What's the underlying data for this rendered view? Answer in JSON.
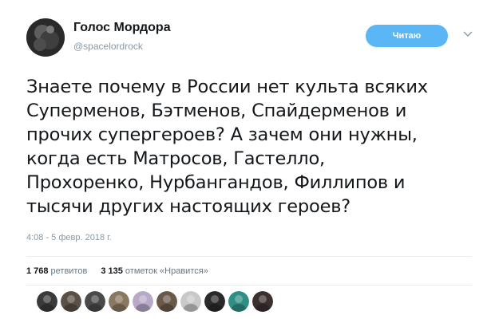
{
  "author": {
    "display_name": "Голос Мордора",
    "handle": "@spacelordrock",
    "avatar_icon": "avatar-photo"
  },
  "follow_button": {
    "label": "Читаю",
    "color": "#5bb6f5"
  },
  "menu_icon": "chevron-down-icon",
  "tweet": {
    "lines": [
      "Знаете почему в России нет культа всяких",
      "Суперменов, Бэтменов, Спайдерменов и",
      "прочих супергероев? А зачем они нужны,",
      "когда есть Матросов, Гастелло,",
      "Прохоренко, Нурбангандов, Филлипов и",
      "тысячи других настоящих героев?"
    ],
    "timestamp": "4:08 - 5 февр. 2018 г."
  },
  "stats": {
    "retweets_count": "1 768",
    "retweets_label": "ретвитов",
    "likes_count": "3 135",
    "likes_label": "отметок «Нравится»"
  },
  "likers": [
    {
      "icon": "liker-avatar",
      "color": "#3a3a3a"
    },
    {
      "icon": "liker-avatar",
      "color": "#5a5046"
    },
    {
      "icon": "liker-avatar",
      "color": "#4a4a4a"
    },
    {
      "icon": "liker-avatar",
      "color": "#8a7860"
    },
    {
      "icon": "liker-avatar",
      "color": "#b9a9c8"
    },
    {
      "icon": "liker-avatar",
      "color": "#6b5a4a"
    },
    {
      "icon": "liker-avatar",
      "color": "#c9c9c9"
    },
    {
      "icon": "liker-avatar",
      "color": "#2a2a2a"
    },
    {
      "icon": "liker-avatar",
      "color": "#2f8f86"
    },
    {
      "icon": "liker-avatar",
      "color": "#3b3030"
    }
  ],
  "colors": {
    "text": "#14171a",
    "muted": "#8899a6",
    "divider": "#e6ecf0"
  }
}
